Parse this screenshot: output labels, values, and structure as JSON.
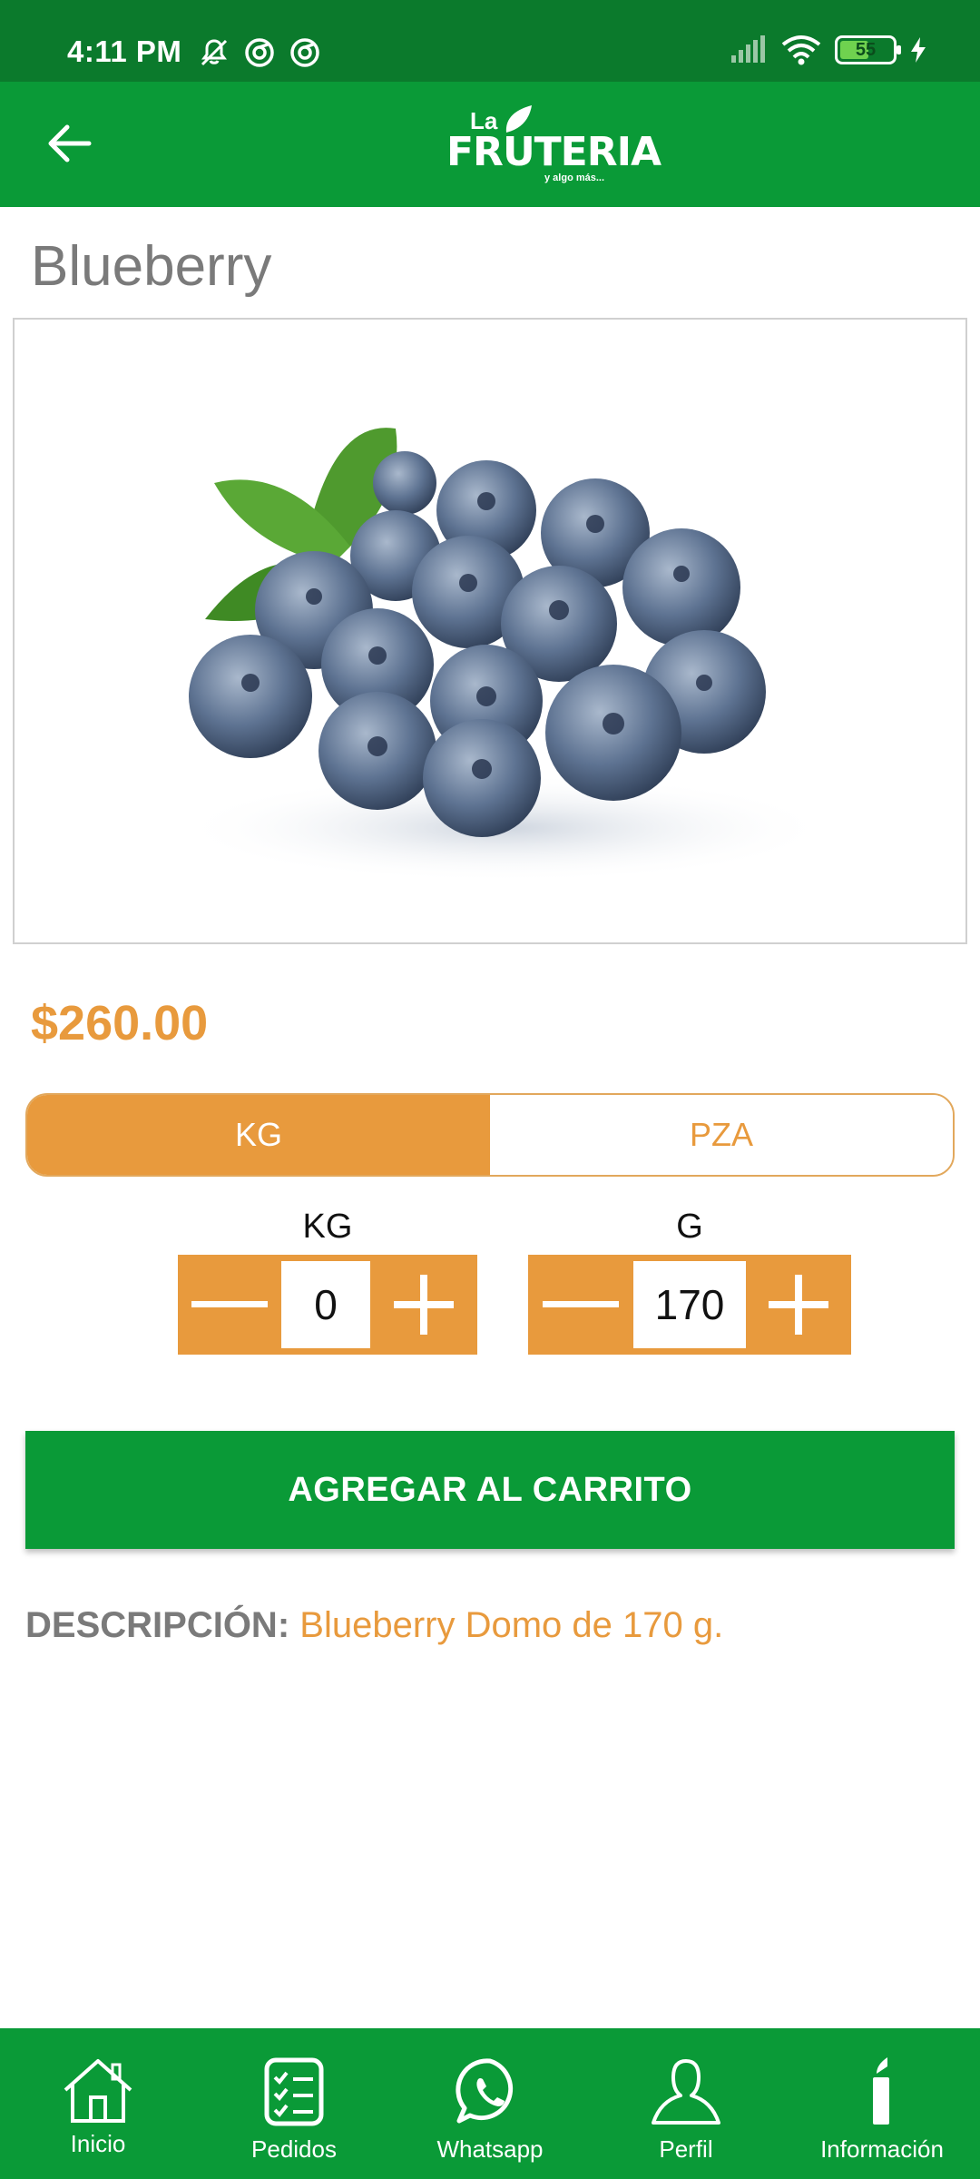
{
  "status_bar": {
    "time": "4:11 PM",
    "battery_level": 55,
    "battery_text": "55",
    "icons_left": [
      "mute-icon",
      "sync-icon",
      "sync-icon"
    ],
    "icons_right": [
      "signal-icon",
      "wifi-icon",
      "battery-icon",
      "charging-icon"
    ]
  },
  "header": {
    "back_icon": "arrow-left-icon",
    "logo_la": "La",
    "logo_main": "FRUTERIA",
    "logo_tagline": "y algo más..."
  },
  "product": {
    "title": "Blueberry",
    "image": "blueberries-photo",
    "price": "$260.00"
  },
  "unit_toggle": {
    "options": [
      {
        "label": "KG",
        "active": true
      },
      {
        "label": "PZA",
        "active": false
      }
    ]
  },
  "quantity": {
    "kg": {
      "label": "KG",
      "value": "0"
    },
    "g": {
      "label": "G",
      "value": "170"
    }
  },
  "actions": {
    "add_to_cart_label": "AGREGAR AL CARRITO"
  },
  "description": {
    "label": "DESCRIPCIÓN:",
    "text": "Blueberry Domo de 170 g."
  },
  "bottom_nav": {
    "items": [
      {
        "label": "Inicio",
        "icon": "home-icon"
      },
      {
        "label": "Pedidos",
        "icon": "orders-icon"
      },
      {
        "label": "Whatsapp",
        "icon": "whatsapp-icon"
      },
      {
        "label": "Perfil",
        "icon": "profile-icon"
      },
      {
        "label": "Información",
        "icon": "info-icon"
      }
    ]
  },
  "colors": {
    "status_bar": "#0b7a2c",
    "primary_green": "#0a9a37",
    "accent_orange": "#e89a3d",
    "title_gray": "#7a7a7a"
  }
}
